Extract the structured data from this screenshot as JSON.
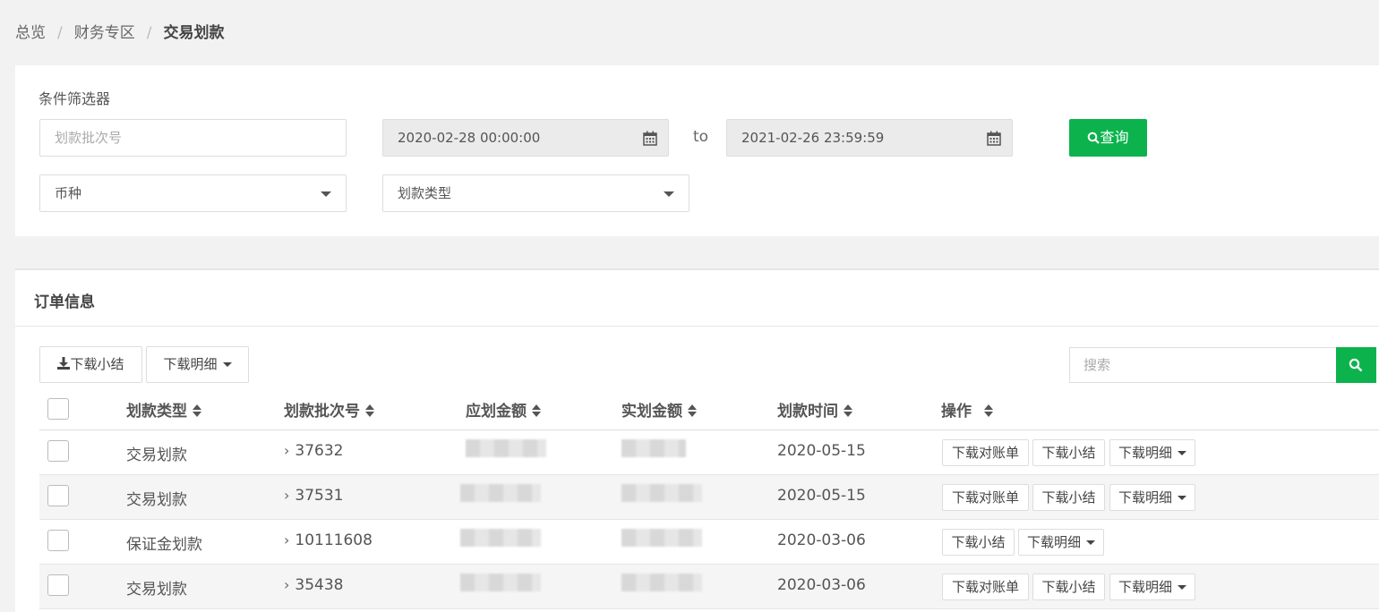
{
  "breadcrumb": {
    "home": "总览",
    "section": "财务专区",
    "current": "交易划款"
  },
  "filter": {
    "title": "条件筛选器",
    "batch_placeholder": "划款批次号",
    "date_from": "2020-02-28 00:00:00",
    "to_label": "to",
    "date_to": "2021-02-26 23:59:59",
    "query_label": "查询",
    "currency_placeholder": "币种",
    "type_placeholder": "划款类型"
  },
  "orders": {
    "title": "订单信息",
    "download_summary": "下载小结",
    "download_detail": "下载明细",
    "search_placeholder": "搜索",
    "columns": {
      "type": "划款类型",
      "batch": "划款批次号",
      "due_amount": "应划金额",
      "actual_amount": "实划金额",
      "time": "划款时间",
      "ops": "操作"
    },
    "row_ops": {
      "statement": "下载对账单",
      "summary": "下载小结",
      "detail": "下载明细"
    },
    "rows": [
      {
        "type": "交易划款",
        "batch": "37632",
        "time": "2020-05-15"
      },
      {
        "type": "交易划款",
        "batch": "37531",
        "time": "2020-05-15"
      },
      {
        "type": "保证金划款",
        "batch": "10111608",
        "time": "2020-03-06"
      },
      {
        "type": "交易划款",
        "batch": "35438",
        "time": "2020-03-06"
      }
    ]
  },
  "colors": {
    "accent": "#0cb34d"
  }
}
